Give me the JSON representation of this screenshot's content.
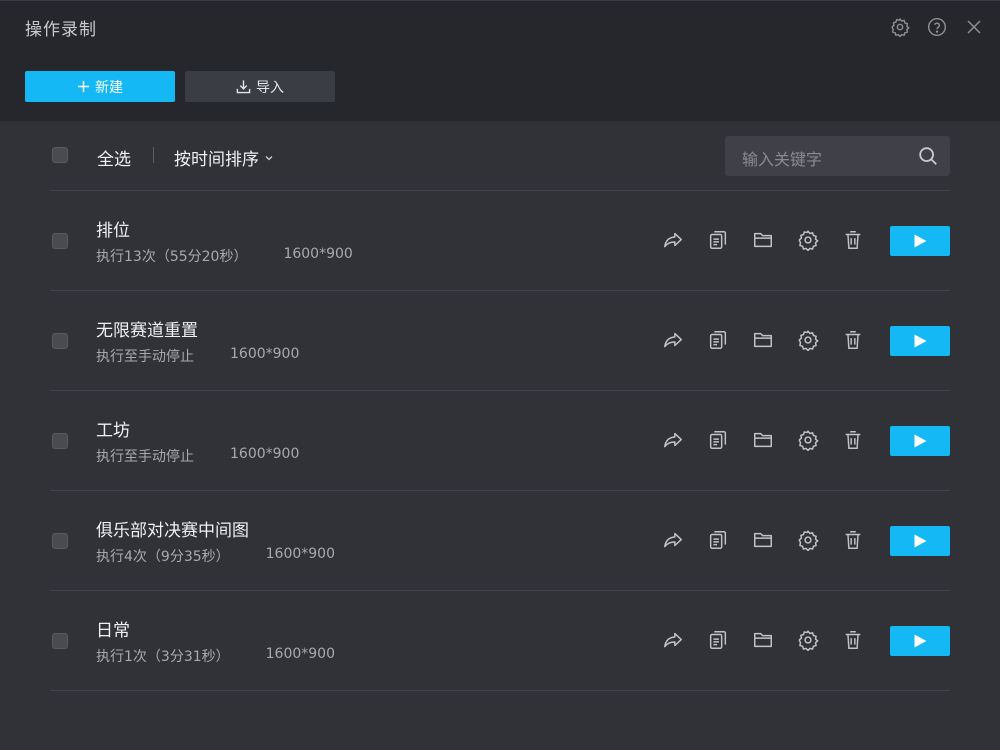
{
  "window": {
    "title": "操作录制",
    "icons": [
      "gear-icon",
      "help-icon",
      "close-icon"
    ]
  },
  "actions": {
    "new_label": "新建",
    "import_label": "导入"
  },
  "toolbar": {
    "select_all": "全选",
    "sort_label": "按时间排序",
    "search_placeholder": "输入关键字"
  },
  "colors": {
    "accent": "#13b8f5",
    "background": "#313238",
    "header": "#26272c"
  },
  "recordings": [
    {
      "name": "排位",
      "status": "执行13次（55分20秒）",
      "resolution": "1600*900"
    },
    {
      "name": "无限赛道重置",
      "status": "执行至手动停止",
      "resolution": "1600*900"
    },
    {
      "name": "工坊",
      "status": "执行至手动停止",
      "resolution": "1600*900"
    },
    {
      "name": "俱乐部对决赛中间图",
      "status": "执行4次（9分35秒）",
      "resolution": "1600*900"
    },
    {
      "name": "日常",
      "status": "执行1次（3分31秒）",
      "resolution": "1600*900"
    }
  ],
  "row_actions": [
    "share-icon",
    "copy-icon",
    "folder-icon",
    "settings-icon",
    "delete-icon",
    "play-icon"
  ]
}
